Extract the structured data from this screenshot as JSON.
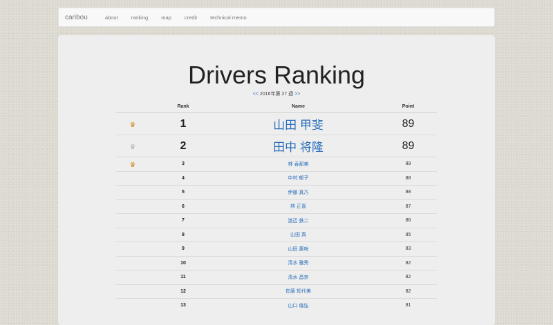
{
  "navbar": {
    "brand": "caribou",
    "links": [
      "about",
      "ranking",
      "map",
      "credit",
      "technical memo"
    ]
  },
  "page": {
    "title": "Drivers Ranking",
    "week_nav": {
      "prev": "<<",
      "label": "2016年第 27 週",
      "next": ">>"
    }
  },
  "table": {
    "headers": {
      "rank": "Rank",
      "name": "Name",
      "point": "Point"
    },
    "rows": [
      {
        "crown": "gold",
        "rank": "1",
        "name": "山田 甲斐",
        "point": "89"
      },
      {
        "crown": "silver",
        "rank": "2",
        "name": "田中 将隆",
        "point": "89"
      },
      {
        "crown": "gold",
        "rank": "3",
        "name": "林 香那美",
        "point": "89"
      },
      {
        "crown": "",
        "rank": "4",
        "name": "中村 郁子",
        "point": "88"
      },
      {
        "crown": "",
        "rank": "5",
        "name": "伊藤 真乃",
        "point": "88"
      },
      {
        "crown": "",
        "rank": "6",
        "name": "林 正喜",
        "point": "87"
      },
      {
        "crown": "",
        "rank": "7",
        "name": "渡辺 鉄二",
        "point": "86"
      },
      {
        "crown": "",
        "rank": "8",
        "name": "山田 真",
        "point": "85"
      },
      {
        "crown": "",
        "rank": "9",
        "name": "山田 惠咲",
        "point": "83"
      },
      {
        "crown": "",
        "rank": "10",
        "name": "清水 雅秀",
        "point": "82"
      },
      {
        "crown": "",
        "rank": "11",
        "name": "清水 昌奈",
        "point": "82"
      },
      {
        "crown": "",
        "rank": "12",
        "name": "佐藤 知代美",
        "point": "82"
      },
      {
        "crown": "",
        "rank": "13",
        "name": "山口 倫弘",
        "point": "81"
      }
    ]
  },
  "icons": {
    "crown": "crown-icon"
  },
  "colors": {
    "link": "#2a6ebb",
    "gold_crown": "#d08b26",
    "silver_crown": "#b5b5b5"
  }
}
